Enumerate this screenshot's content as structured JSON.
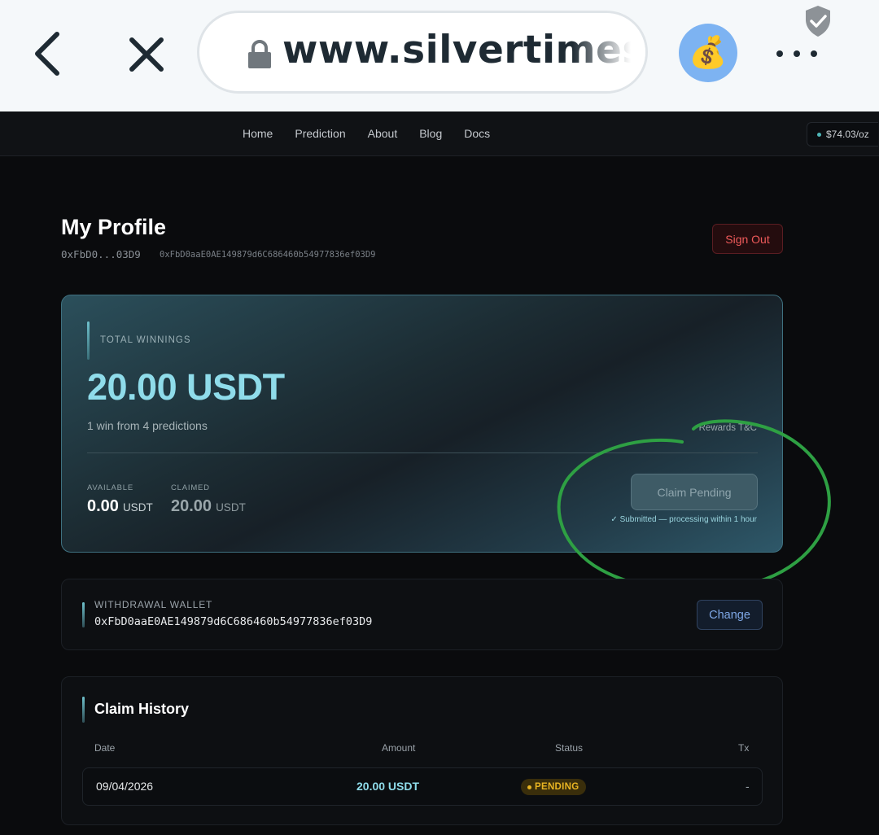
{
  "browser": {
    "url": "www.silvertimes.",
    "extension_icon": "money-bag-icon",
    "extension_emoji": "💰"
  },
  "nav": {
    "links": [
      "Home",
      "Prediction",
      "About",
      "Blog",
      "Docs"
    ],
    "price": "$74.03/oz"
  },
  "profile": {
    "title": "My Profile",
    "address_short": "0xFbD0...03D9",
    "address_full": "0xFbD0aaE0AE149879d6C686460b54977836ef03D9",
    "sign_out": "Sign Out"
  },
  "winnings": {
    "label": "TOTAL WINNINGS",
    "amount": "20.00 USDT",
    "subtitle": "1 win from 4 predictions",
    "rewards_link": "Rewards T&C",
    "available_label": "AVAILABLE",
    "available_value": "0.00",
    "available_unit": "USDT",
    "claimed_label": "CLAIMED",
    "claimed_value": "20.00",
    "claimed_unit": "USDT",
    "claim_button": "Claim Pending",
    "claim_note": "✓  Submitted — processing within 1 hour"
  },
  "wallet": {
    "label": "WITHDRAWAL WALLET",
    "address": "0xFbD0aaE0AE149879d6C686460b54977836ef03D9",
    "change_button": "Change"
  },
  "history": {
    "title": "Claim History",
    "columns": [
      "Date",
      "Amount",
      "Status",
      "Tx"
    ],
    "rows": [
      {
        "date": "09/04/2026",
        "amount": "20.00 USDT",
        "status": "PENDING",
        "tx": "-"
      }
    ]
  },
  "colors": {
    "accent_cyan": "#8fdcea",
    "danger": "#ef5a5a",
    "pending": "#e8b422",
    "annotation_green": "#2ea043"
  }
}
